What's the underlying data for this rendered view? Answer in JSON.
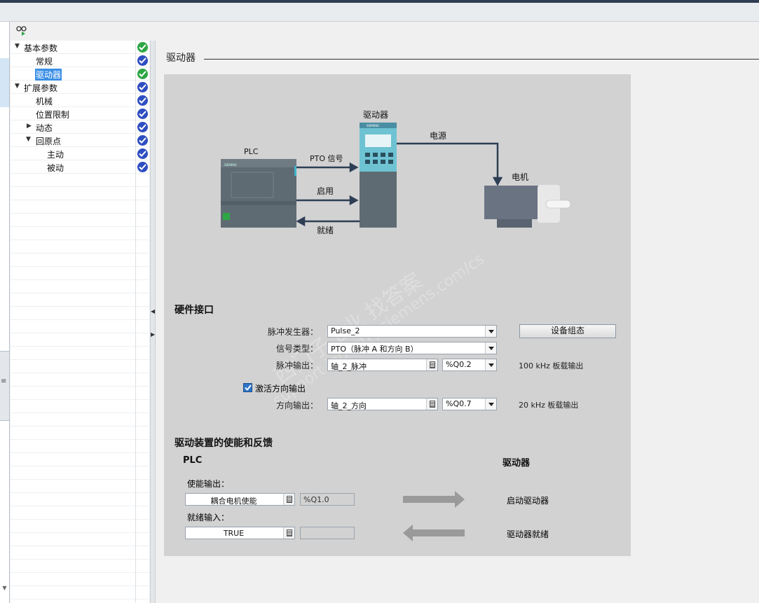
{
  "nav": {
    "items": [
      {
        "label": "基本参数",
        "level": 0,
        "expanded": true,
        "status": "green"
      },
      {
        "label": "常规",
        "level": 1,
        "status": "blue"
      },
      {
        "label": "驱动器",
        "level": 1,
        "selected": true,
        "status": "green"
      },
      {
        "label": "扩展参数",
        "level": 0,
        "expanded": true,
        "status": "blue"
      },
      {
        "label": "机械",
        "level": 1,
        "status": "blue"
      },
      {
        "label": "位置限制",
        "level": 1,
        "status": "blue"
      },
      {
        "label": "动态",
        "level": 1,
        "collapsed": true,
        "status": "blue"
      },
      {
        "label": "回原点",
        "level": 1,
        "expanded": true,
        "status": "blue"
      },
      {
        "label": "主动",
        "level": 2,
        "status": "blue"
      },
      {
        "label": "被动",
        "level": 2,
        "status": "blue"
      }
    ]
  },
  "section_title": "驱动器",
  "diagram": {
    "plc_label": "PLC",
    "drive_label": "驱动器",
    "motor_label": "电机",
    "power_label": "电源",
    "pto_label": "PTO 信号",
    "enable_label": "启用",
    "ready_label": "就绪",
    "plc_brand": "SIEMENS",
    "drive_brand": "SIEMENS"
  },
  "hardware": {
    "heading": "硬件接口",
    "pulse_gen_label": "脉冲发生器：",
    "pulse_gen_value": "Pulse_2",
    "config_button": "设备组态",
    "signal_type_label": "信号类型：",
    "signal_type_value": "PTO（脉冲 A 和方向 B）",
    "pulse_out_label": "脉冲输出：",
    "pulse_out_value": "轴_2_脉冲",
    "pulse_out_addr": "%Q0.2",
    "pulse_out_note": "100 kHz 板载输出",
    "activate_dir_label": "激活方向输出",
    "activate_dir_checked": true,
    "dir_out_label": "方向输出：",
    "dir_out_value": "轴_2_方向",
    "dir_out_addr": "%Q0.7",
    "dir_out_note": "20 kHz 板载输出"
  },
  "enable": {
    "heading": "驱动装置的使能和反馈",
    "plc_col": "PLC",
    "drive_col": "驱动器",
    "enable_out_label": "使能输出：",
    "enable_out_value": "耦合电机使能",
    "enable_out_addr": "%Q1.0",
    "enable_target": "启动驱动器",
    "ready_in_label": "就绪输入：",
    "ready_in_value": "TRUE",
    "ready_in_addr": "",
    "ready_source": "驱动器就绪"
  },
  "watermark": {
    "line1": "西门子工业  找答案",
    "line2": "support.industry.siemens.com/cs"
  }
}
